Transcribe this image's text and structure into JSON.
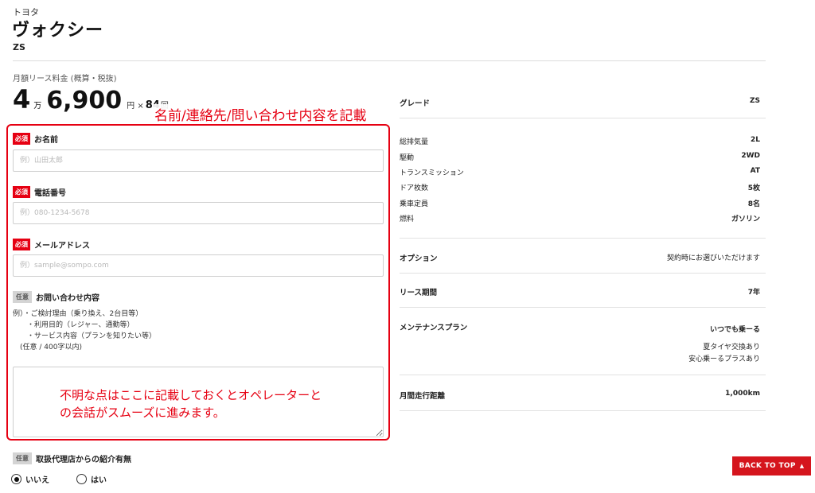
{
  "car": {
    "maker": "トヨタ",
    "model": "ヴォクシー",
    "grade_code": "ZS"
  },
  "price": {
    "label": "月額リース料金 (概算・税抜)",
    "man_value": "4",
    "man_unit": "万",
    "yen_value": "6,900",
    "yen_unit": "円 ×",
    "months_value": "84",
    "months_unit": "回"
  },
  "annotations": {
    "form_header": "名前/連絡先/問い合わせ内容を記載",
    "textarea_note_line1": "不明な点はここに記載しておくとオペレーターと",
    "textarea_note_line2": "の会話がスムーズに進みます。"
  },
  "form": {
    "required_badge": "必須",
    "optional_badge": "任意",
    "name": {
      "label": "お名前",
      "placeholder": "例）山田太郎"
    },
    "phone": {
      "label": "電話番号",
      "placeholder": "例）080-1234-5678"
    },
    "email": {
      "label": "メールアドレス",
      "placeholder": "例）sample@sompo.com"
    },
    "inquiry": {
      "label": "お問い合わせ内容",
      "example_lines": [
        "例）・ご検討理由（乗り換え、2台目等）",
        "　　・利用目的（レジャー、通勤等）",
        "　　・サービス内容（プランを知りたい等）",
        "　(任意 / 400字以内)"
      ]
    },
    "referral": {
      "label": "取扱代理店からの紹介有無",
      "options": [
        "いいえ",
        "はい"
      ],
      "selected": "いいえ"
    }
  },
  "spec": {
    "grade": {
      "label": "グレード",
      "value": "ZS"
    },
    "rows": [
      {
        "label": "総排気量",
        "value": "2L"
      },
      {
        "label": "駆動",
        "value": "2WD"
      },
      {
        "label": "トランスミッション",
        "value": "AT"
      },
      {
        "label": "ドア枚数",
        "value": "5枚"
      },
      {
        "label": "乗車定員",
        "value": "8名"
      },
      {
        "label": "燃料",
        "value": "ガソリン"
      }
    ],
    "option": {
      "label": "オプション",
      "value": "契約時にお選びいただけます"
    },
    "lease_period": {
      "label": "リース期間",
      "value": "7年"
    },
    "maintenance": {
      "label": "メンテナンスプラン",
      "value": "いつでも乗ーる",
      "details": [
        "夏タイヤ交換あり",
        "安心乗ーるプラスあり"
      ]
    },
    "mileage": {
      "label": "月間走行距離",
      "value": "1,000km"
    }
  },
  "back_to_top": {
    "label": "BACK TO TOP",
    "icon": "caret-up-icon"
  },
  "colors": {
    "accent": "#e60012",
    "button": "#d5151d"
  }
}
